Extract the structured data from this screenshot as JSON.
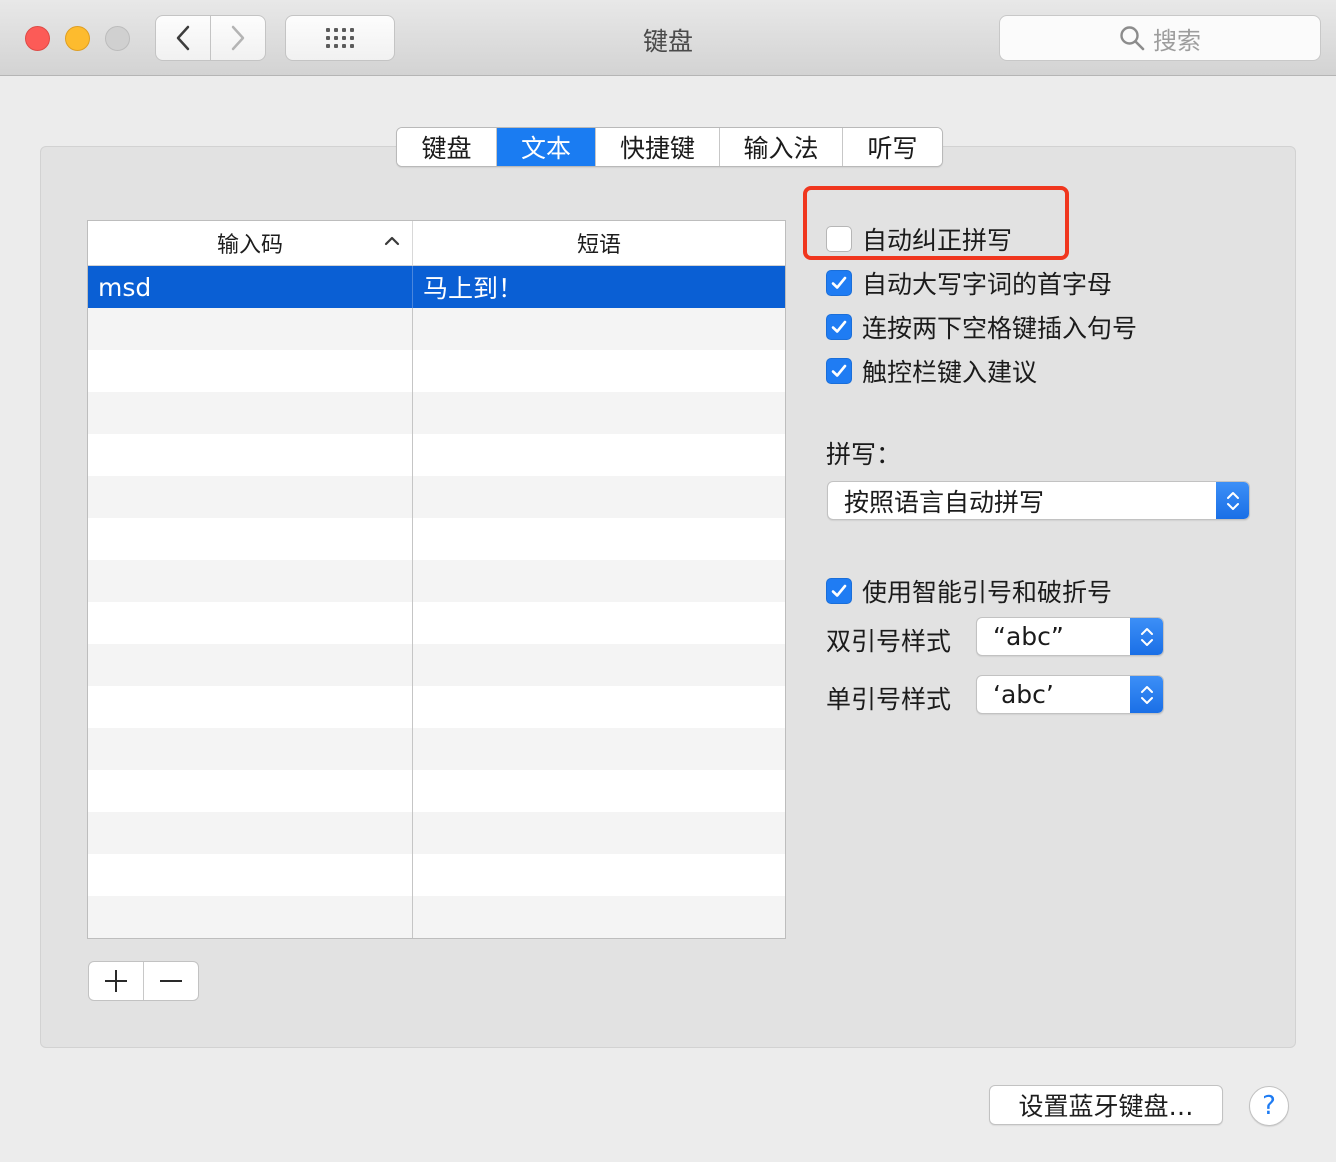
{
  "window": {
    "title": "键盘",
    "search_placeholder": "搜索"
  },
  "tabs": [
    {
      "label": "键盘",
      "active": false
    },
    {
      "label": "文本",
      "active": true
    },
    {
      "label": "快捷键",
      "active": false
    },
    {
      "label": "输入法",
      "active": false
    },
    {
      "label": "听写",
      "active": false
    }
  ],
  "table": {
    "col1_header": "输入码",
    "col2_header": "短语",
    "rows": [
      {
        "code": "msd",
        "phrase": "马上到！",
        "selected": true
      }
    ]
  },
  "options": {
    "auto_correct": {
      "label": "自动纠正拼写",
      "checked": false
    },
    "auto_capitalize": {
      "label": "自动大写字词的首字母",
      "checked": true
    },
    "double_space": {
      "label": "连按两下空格键插入句号",
      "checked": true
    },
    "touchbar": {
      "label": "触控栏键入建议",
      "checked": true
    }
  },
  "spelling": {
    "label": "拼写：",
    "value": "按照语言自动拼写"
  },
  "smart_quotes": {
    "label": "使用智能引号和破折号",
    "checked": true
  },
  "double_quote": {
    "label": "双引号样式",
    "value": "“abc”"
  },
  "single_quote": {
    "label": "单引号样式",
    "value": "‘abc’"
  },
  "buttons": {
    "bluetooth": "设置蓝牙键盘…",
    "help": "?"
  },
  "colors": {
    "accent": "#1f7cf3",
    "selection": "#0a5fd4",
    "highlight_box": "#f0361e"
  }
}
